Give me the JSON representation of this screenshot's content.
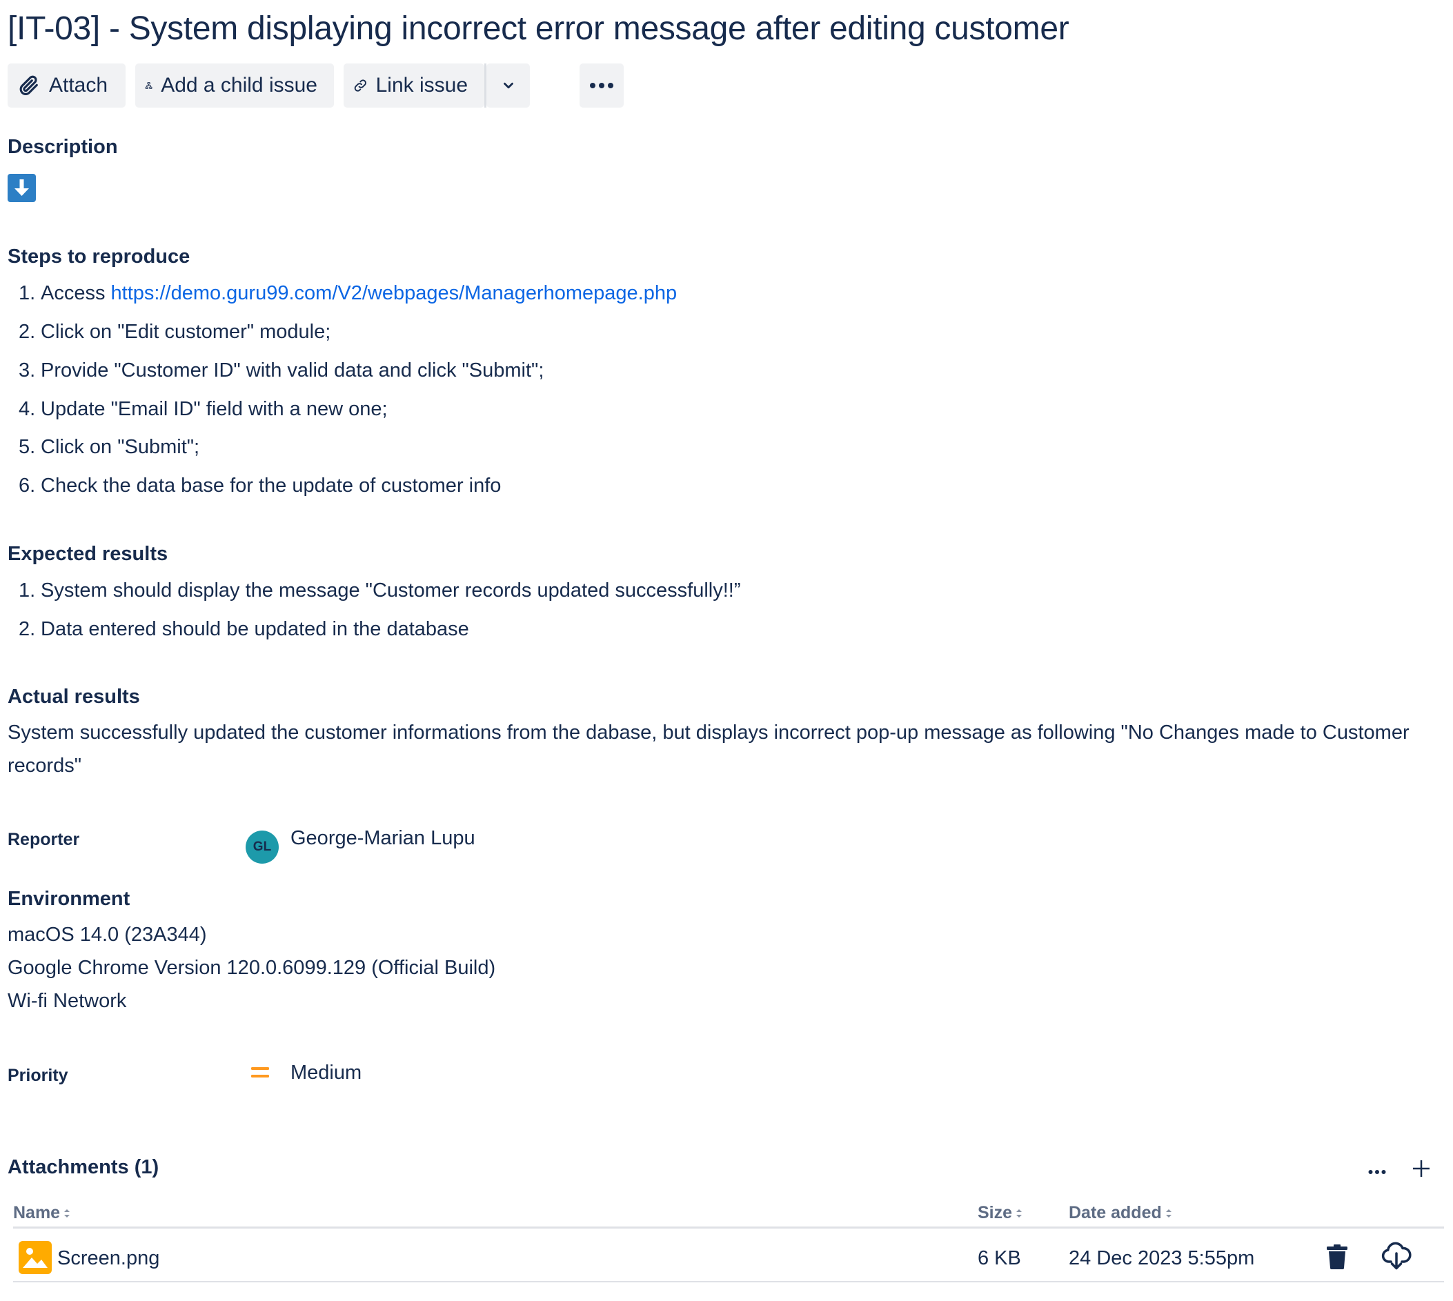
{
  "issue": {
    "title": "[IT-03] - System displaying incorrect error message after editing customer"
  },
  "toolbar": {
    "attach_label": "Attach",
    "child_issue_label": "Add a child issue",
    "link_issue_label": "Link issue"
  },
  "description": {
    "heading": "Description",
    "steps_heading": "Steps to reproduce",
    "steps": [
      {
        "num": "1.",
        "prefix": "Access ",
        "link": "https://demo.guru99.com/V2/webpages/Managerhomepage.php"
      },
      {
        "num": "2.",
        "text": "Click on \"Edit customer\" module;"
      },
      {
        "num": "3.",
        "text": "Provide \"Customer ID\" with valid data and click \"Submit\";"
      },
      {
        "num": "4.",
        "text": "Update \"Email ID\" field with a new one;"
      },
      {
        "num": "5.",
        "text": "Click on \"Submit\";"
      },
      {
        "num": "6.",
        "text": "Check the data base for the update of customer info"
      }
    ],
    "expected_heading": "Expected results",
    "expected": [
      {
        "num": "1.",
        "text": "System should display the message \"Customer records updated successfully!!”"
      },
      {
        "num": "2.",
        "text": "Data entered should be updated in the database"
      }
    ],
    "actual_heading": "Actual results",
    "actual_line1": "System successfully updated the customer informations from the dabase, but displays incorrect pop-up message as following \"No Changes made to Customer",
    "actual_line2": "records\""
  },
  "reporter": {
    "label": "Reporter",
    "initials": "GL",
    "name": "George-Marian Lupu",
    "avatar_color": "#1d9aaa"
  },
  "environment": {
    "heading": "Environment",
    "lines": [
      "macOS 14.0 (23A344)",
      "Google Chrome Version 120.0.6099.129 (Official Build)",
      "Wi-fi Network"
    ]
  },
  "priority": {
    "label": "Priority",
    "value": "Medium",
    "icon": "priority-medium-icon",
    "color": "#ff991f"
  },
  "attachments": {
    "heading": "Attachments (1)",
    "columns": {
      "name": "Name",
      "size": "Size",
      "date": "Date added"
    },
    "rows": [
      {
        "name": "Screen.png",
        "size": "6 KB",
        "date": "24 Dec 2023 5:55pm",
        "icon": "image-file-icon"
      }
    ]
  },
  "colors": {
    "text": "#172b4d",
    "link": "#0c66e4",
    "button_bg": "#f1f2f4",
    "description_icon": "#2d7fc5",
    "image_icon": "#ffab00"
  }
}
